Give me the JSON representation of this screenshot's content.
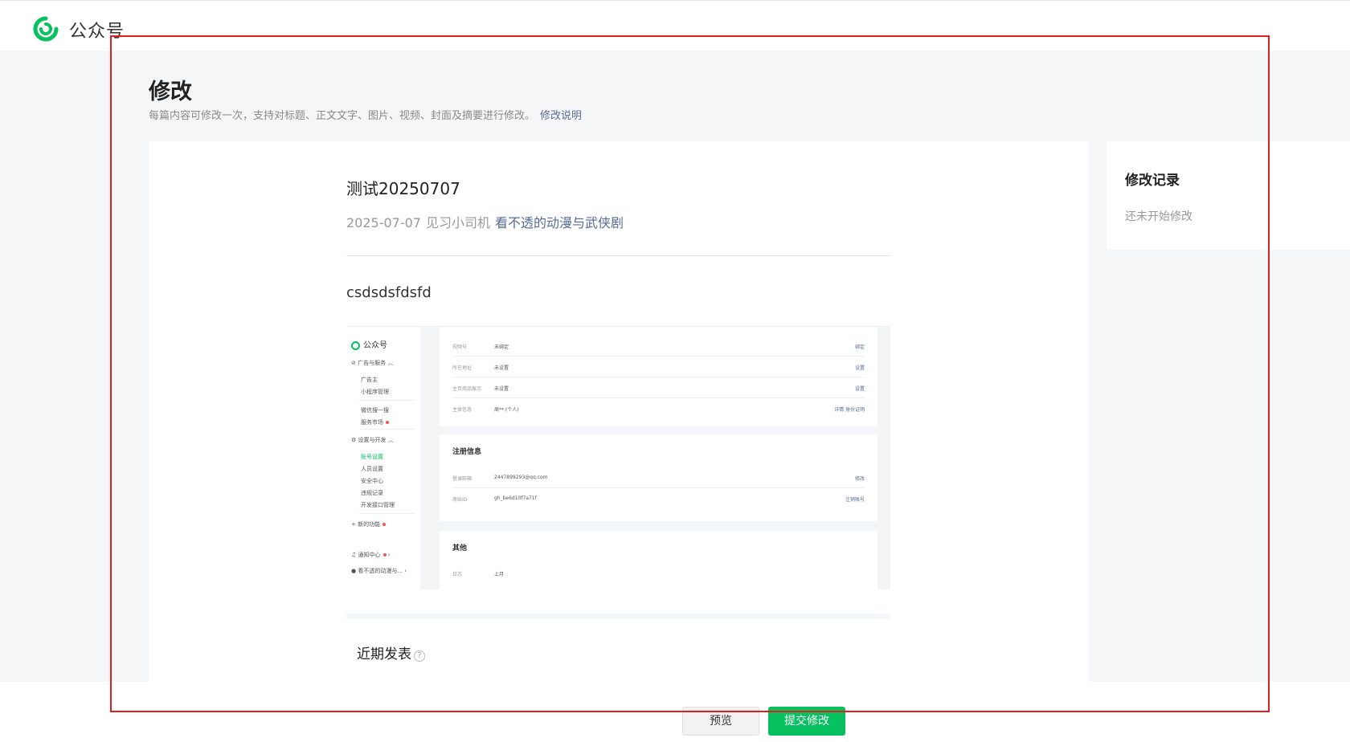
{
  "header": {
    "brand": "公众号"
  },
  "page": {
    "title": "修改",
    "description": "每篇内容可修改一次，支持对标题、正文文字、图片、视频、封面及摘要进行修改。",
    "help_link": "修改说明"
  },
  "article": {
    "title": "测试20250707",
    "date": "2025-07-07",
    "author": "见习小司机",
    "account": "看不透的动漫与武侠剧",
    "body": "csdsdsfdsfd"
  },
  "embedded_screenshot": {
    "brand": "公众号",
    "sidebar": [
      {
        "label": "广告与服务"
      },
      {
        "label": "广告主"
      },
      {
        "label": "小程序管理"
      },
      {
        "label": "微信搜一搜"
      },
      {
        "label": "服务市场"
      },
      {
        "label": "设置与开发"
      },
      {
        "label": "账号设置"
      },
      {
        "label": "人员设置"
      },
      {
        "label": "安全中心"
      },
      {
        "label": "违规记录"
      },
      {
        "label": "开发接口管理"
      },
      {
        "label": "新的功能"
      },
      {
        "label": "通知中心"
      },
      {
        "label": "看不透的动漫与..."
      }
    ],
    "account_rows": [
      {
        "key": "视频号",
        "value": "未绑定",
        "action": "绑定"
      },
      {
        "key": "所在地址",
        "value": "未设置",
        "action": "设置"
      },
      {
        "key": "主页商品展示",
        "value": "未设置",
        "action": "设置"
      },
      {
        "key": "主体信息",
        "value": "周** (个人)",
        "action": "详情 身份证明"
      }
    ],
    "register_title": "注册信息",
    "register_rows": [
      {
        "key": "登录邮箱",
        "value": "2447899293@qq.com",
        "action": "修改"
      },
      {
        "key": "原始ID",
        "value": "gh_be6d10f7a71f",
        "action": "注销账号"
      }
    ],
    "other_title": "其他",
    "other_rows": [
      {
        "key": "日志",
        "value": "上月",
        "action": ""
      }
    ]
  },
  "recent": {
    "label": "近期发表",
    "help_icon": "?"
  },
  "sidebar": {
    "title": "修改记录",
    "empty_text": "还未开始修改"
  },
  "footer": {
    "preview_label": "预览",
    "submit_label": "提交修改"
  },
  "colors": {
    "brand_green": "#07c160",
    "link_blue": "#576b95",
    "annotation_red": "#e02020"
  }
}
